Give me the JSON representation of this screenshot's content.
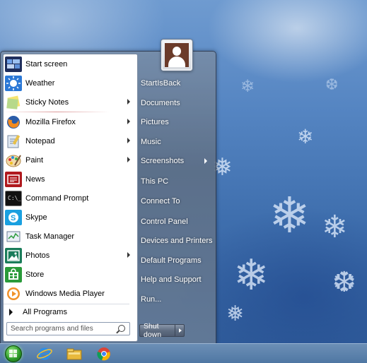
{
  "start_menu": {
    "programs": [
      {
        "label": "Start screen",
        "icon": "start-screen-icon",
        "submenu": false
      },
      {
        "label": "Weather",
        "icon": "weather-icon",
        "submenu": false
      },
      {
        "label": "Sticky Notes",
        "icon": "sticky-notes-icon",
        "submenu": true
      },
      {
        "label": "Mozilla Firefox",
        "icon": "firefox-icon",
        "submenu": true
      },
      {
        "label": "Notepad",
        "icon": "notepad-icon",
        "submenu": true
      },
      {
        "label": "Paint",
        "icon": "paint-icon",
        "submenu": true
      },
      {
        "label": "News",
        "icon": "news-icon",
        "submenu": false
      },
      {
        "label": "Command Prompt",
        "icon": "command-prompt-icon",
        "submenu": false
      },
      {
        "label": "Skype",
        "icon": "skype-icon",
        "submenu": false
      },
      {
        "label": "Task Manager",
        "icon": "task-manager-icon",
        "submenu": false
      },
      {
        "label": "Photos",
        "icon": "photos-icon",
        "submenu": true
      },
      {
        "label": "Store",
        "icon": "store-icon",
        "submenu": false
      },
      {
        "label": "Windows Media Player",
        "icon": "media-player-icon",
        "submenu": false
      }
    ],
    "all_programs": "All Programs",
    "search_placeholder": "Search programs and files",
    "right_items": [
      {
        "label": "StartIsBack",
        "submenu": false
      },
      {
        "label": "Documents",
        "submenu": false
      },
      {
        "label": "Pictures",
        "submenu": false
      },
      {
        "label": "Music",
        "submenu": false
      },
      {
        "label": "Screenshots",
        "submenu": true
      },
      {
        "label": "This PC",
        "submenu": false
      },
      {
        "label": "Connect To",
        "submenu": false
      },
      {
        "label": "Control Panel",
        "submenu": false
      },
      {
        "label": "Devices and Printers",
        "submenu": false
      },
      {
        "label": "Default Programs",
        "submenu": false
      },
      {
        "label": "Help and Support",
        "submenu": false
      },
      {
        "label": "Run...",
        "submenu": false
      }
    ],
    "shutdown_label": "Shut down"
  },
  "taskbar": {
    "items": [
      "start-orb-icon",
      "internet-explorer-icon",
      "file-explorer-icon",
      "chrome-icon"
    ]
  },
  "colors": {
    "accent_glass": "#7a8ca5",
    "start_orb": "#2f9c2a"
  }
}
